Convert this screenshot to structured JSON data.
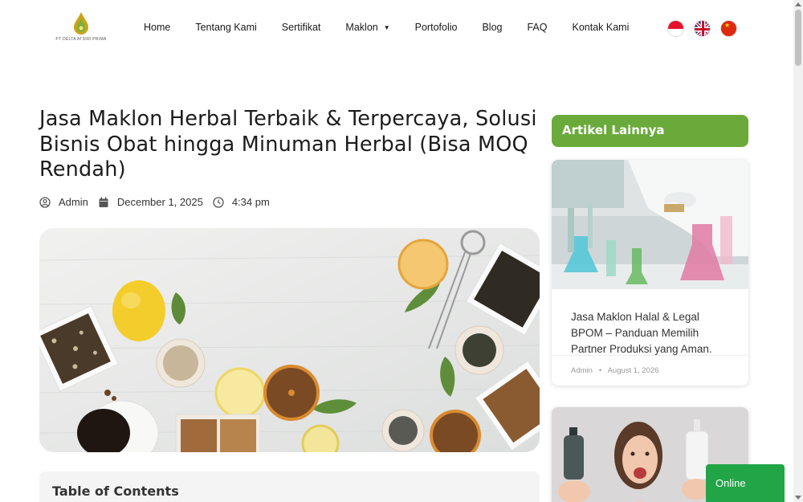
{
  "header": {
    "logo_text": "PT DELTA ATSIRI PRIMA",
    "nav": [
      {
        "label": "Home"
      },
      {
        "label": "Tentang Kami"
      },
      {
        "label": "Sertifikat"
      },
      {
        "label": "Maklon",
        "has_dropdown": true
      },
      {
        "label": "Portofolio"
      },
      {
        "label": "Blog"
      },
      {
        "label": "FAQ"
      },
      {
        "label": "Kontak Kami"
      }
    ],
    "languages": [
      {
        "name": "Indonesian",
        "icon": "flag-indonesia-icon"
      },
      {
        "name": "English",
        "icon": "flag-uk-icon"
      },
      {
        "name": "Chinese",
        "icon": "flag-china-icon"
      }
    ]
  },
  "article": {
    "title": "Jasa Maklon Herbal Terbaik & Terpercaya, Solusi Bisnis Obat hingga Minuman Herbal (Bisa MOQ Rendah)",
    "author": "Admin",
    "date": "December 1, 2025",
    "time": "4:34 pm",
    "toc_title": "Table of Contents"
  },
  "sidebar": {
    "heading": "Artikel Lainnya",
    "cards": [
      {
        "title": "Jasa Maklon Halal & Legal BPOM – Panduan Memilih Partner Produksi yang Aman.",
        "author": "Admin",
        "separator": "•",
        "date": "August 1, 2026"
      }
    ]
  },
  "chat": {
    "label": "Online"
  },
  "colors": {
    "accent_green": "#6aaa3a",
    "chat_green": "#21a547"
  }
}
